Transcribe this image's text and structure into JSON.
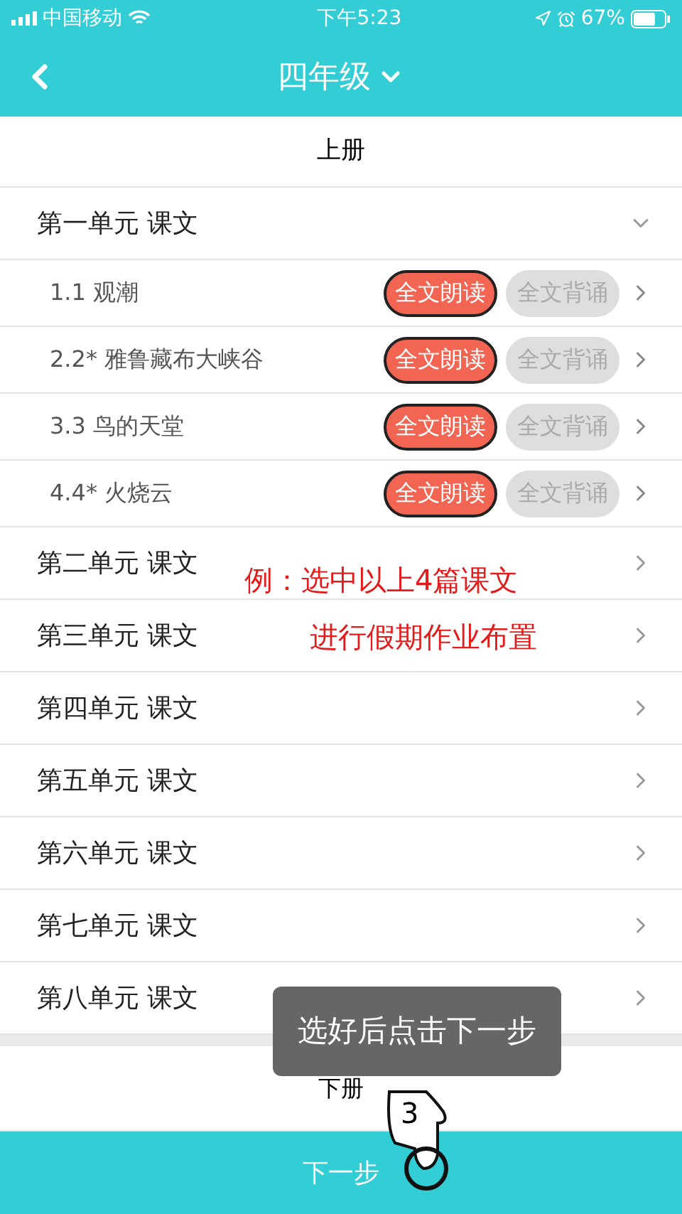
{
  "status_bar": {
    "carrier": "中国移动",
    "time": "下午5:23",
    "battery": "67%"
  },
  "nav": {
    "title": "四年级"
  },
  "volumes": [
    {
      "title": "上册",
      "units": [
        {
          "title": "第一单元 课文",
          "expanded": true,
          "lessons": [
            {
              "title": "1.1 观潮",
              "options": [
                {
                  "label": "全文朗读",
                  "selected": true
                },
                {
                  "label": "全文背诵",
                  "selected": false
                }
              ]
            },
            {
              "title": "2.2* 雅鲁藏布大峡谷",
              "options": [
                {
                  "label": "全文朗读",
                  "selected": true
                },
                {
                  "label": "全文背诵",
                  "selected": false
                }
              ]
            },
            {
              "title": "3.3 鸟的天堂",
              "options": [
                {
                  "label": "全文朗读",
                  "selected": true
                },
                {
                  "label": "全文背诵",
                  "selected": false
                }
              ]
            },
            {
              "title": "4.4* 火烧云",
              "options": [
                {
                  "label": "全文朗读",
                  "selected": true
                },
                {
                  "label": "全文背诵",
                  "selected": false
                }
              ]
            }
          ]
        },
        {
          "title": "第二单元 课文",
          "expanded": false
        },
        {
          "title": "第三单元 课文",
          "expanded": false
        },
        {
          "title": "第四单元 课文",
          "expanded": false
        },
        {
          "title": "第五单元 课文",
          "expanded": false
        },
        {
          "title": "第六单元 课文",
          "expanded": false
        },
        {
          "title": "第七单元 课文",
          "expanded": false
        },
        {
          "title": "第八单元 课文",
          "expanded": false
        }
      ]
    },
    {
      "title": "下册"
    }
  ],
  "annotation": [
    "例：选中以上4篇课文",
    "进行假期作业布置"
  ],
  "tooltip": "选好后点击下一步",
  "hand_step": "3",
  "next_button": "下一步"
}
